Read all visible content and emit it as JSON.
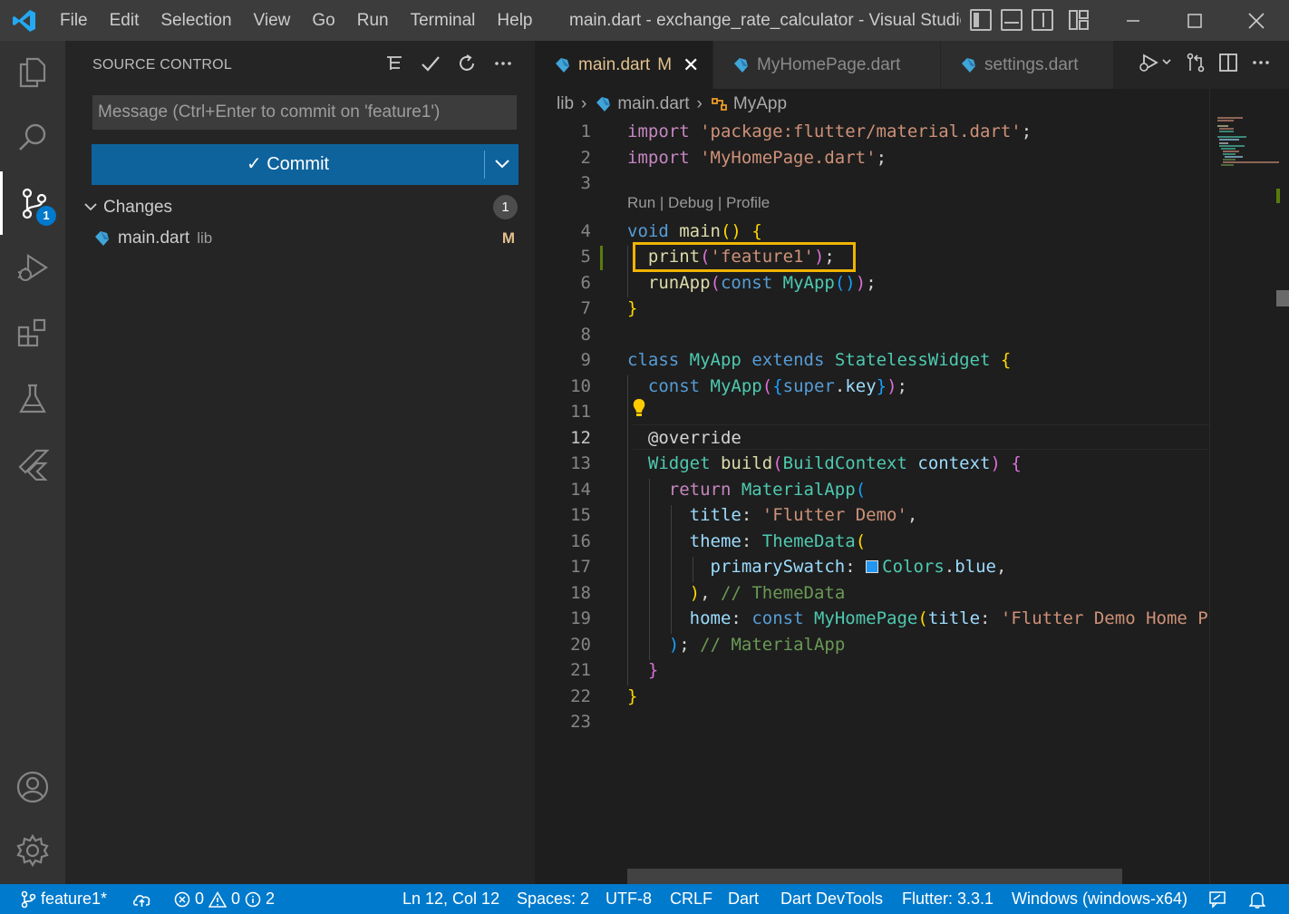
{
  "window": {
    "title": "main.dart - exchange_rate_calculator - Visual Studio ...",
    "menu": [
      "File",
      "Edit",
      "Selection",
      "View",
      "Go",
      "Run",
      "Terminal",
      "Help"
    ]
  },
  "activity_bar": {
    "scm_badge": "1"
  },
  "sidebar": {
    "header": "SOURCE CONTROL",
    "message_placeholder": "Message (Ctrl+Enter to commit on 'feature1')",
    "commit_label": "✓ Commit",
    "changes_label": "Changes",
    "changes_count": "1",
    "file": {
      "name": "main.dart",
      "dir": "lib",
      "status": "M"
    }
  },
  "tabs": [
    {
      "label": "main.dart",
      "modified": "M",
      "active": true
    },
    {
      "label": "MyHomePage.dart"
    },
    {
      "label": "settings.dart"
    }
  ],
  "breadcrumb": {
    "folder": "lib",
    "file": "main.dart",
    "symbol": "MyApp"
  },
  "editor": {
    "codelens": "Run | Debug | Profile",
    "current_line": 12,
    "line_numbers": [
      "1",
      "2",
      "3",
      "4",
      "5",
      "6",
      "7",
      "8",
      "9",
      "10",
      "11",
      "12",
      "13",
      "14",
      "15",
      "16",
      "17",
      "18",
      "19",
      "20",
      "21",
      "22",
      "23"
    ]
  },
  "statusbar": {
    "branch": "feature1*",
    "errors": "0",
    "warnings": "0",
    "infos": "2",
    "position": "Ln 12, Col 12",
    "spaces": "Spaces: 2",
    "encoding": "UTF-8",
    "eol": "CRLF",
    "language": "Dart",
    "devtools": "Dart DevTools",
    "flutter": "Flutter: 3.3.1",
    "device": "Windows (windows-x64)"
  },
  "colors": {
    "accent": "#007acc",
    "commit_button": "#0e639c",
    "highlight_box": "#f0b400",
    "modified": "#e2c08d"
  }
}
